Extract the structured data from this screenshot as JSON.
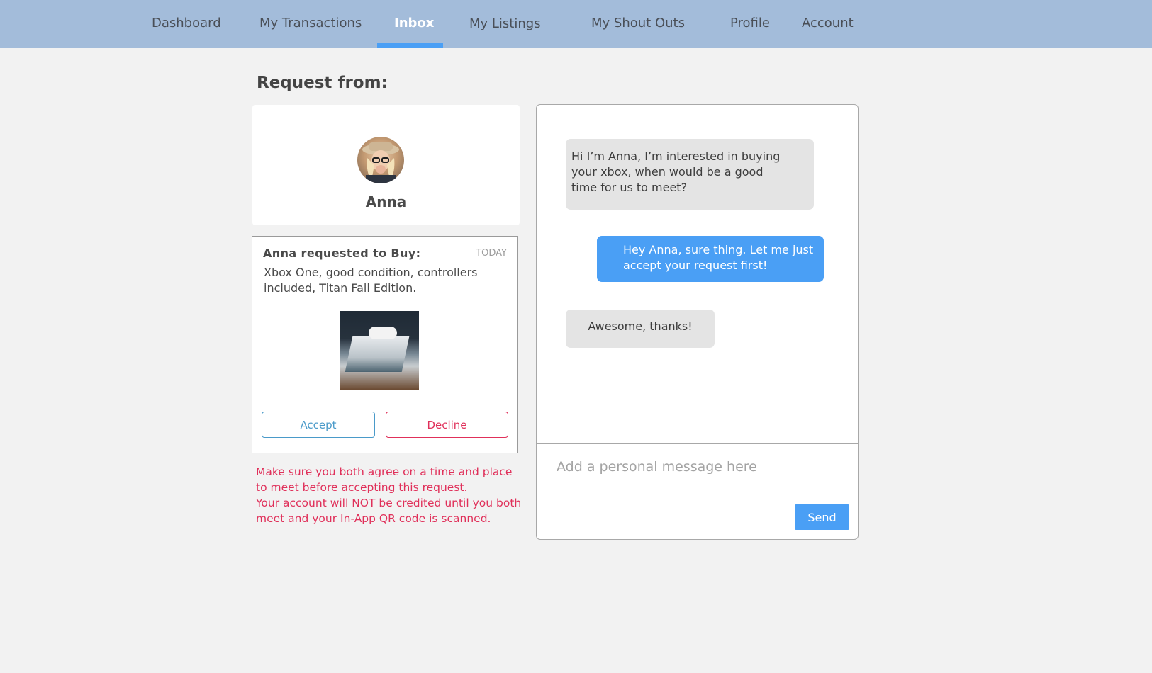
{
  "nav": {
    "items": [
      {
        "label": "Dashboard",
        "active": false
      },
      {
        "label": "My Transactions",
        "active": false
      },
      {
        "label": "Inbox",
        "active": true
      },
      {
        "label": "My Listings",
        "active": false
      },
      {
        "label": "My Shout Outs",
        "active": false
      },
      {
        "label": "Profile",
        "active": false
      },
      {
        "label": "Account",
        "active": false
      }
    ]
  },
  "page": {
    "title": "Request from:"
  },
  "requester": {
    "name": "Anna"
  },
  "request": {
    "heading": "Anna requested to Buy:",
    "date": "TODAY",
    "description": "Xbox One, good condition, controllers included, Titan Fall Edition.",
    "accept_label": "Accept",
    "decline_label": "Decline"
  },
  "warning": {
    "line1": "Make sure you both agree on a time and place to meet before accepting this request.",
    "line2": "Your account will NOT be credited until you both meet and your In-App QR code is scanned."
  },
  "chat": {
    "messages": [
      {
        "from": "Anna",
        "direction": "incoming",
        "text": "Hi I’m Anna, I’m interested in buying your xbox, when would be a good time for us to meet?"
      },
      {
        "from": "me",
        "direction": "outgoing",
        "text": "Hey Anna, sure thing. Let me just accept your request first!"
      },
      {
        "from": "Anna",
        "direction": "incoming",
        "text": "Awesome, thanks!"
      }
    ],
    "input_placeholder": "Add a personal message here",
    "send_label": "Send"
  },
  "colors": {
    "nav_bg": "#a3bcda",
    "accent_blue": "#4a9ff5",
    "danger_red": "#e0305a"
  }
}
